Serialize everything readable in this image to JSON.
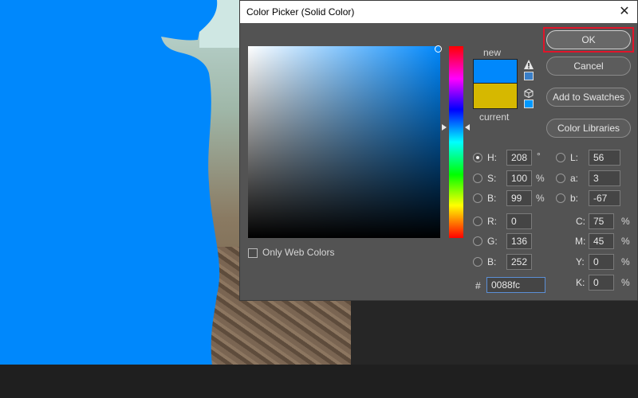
{
  "dialog": {
    "title": "Color Picker (Solid Color)",
    "close_glyph": "✕",
    "buttons": {
      "ok": "OK",
      "cancel": "Cancel",
      "add_to_swatches": "Add to Swatches",
      "color_libraries": "Color Libraries"
    },
    "swatch": {
      "new_label": "new",
      "current_label": "current",
      "new_color": "#0088fc",
      "current_color": "#d6b800"
    },
    "only_web_colors": "Only Web Colors",
    "hsb": {
      "h_label": "H:",
      "h_value": "208",
      "h_unit": "°",
      "s_label": "S:",
      "s_value": "100",
      "s_unit": "%",
      "b_label": "B:",
      "b_value": "99",
      "b_unit": "%"
    },
    "rgb": {
      "r_label": "R:",
      "r_value": "0",
      "g_label": "G:",
      "g_value": "136",
      "b_label": "B:",
      "b_value": "252"
    },
    "lab": {
      "l_label": "L:",
      "l_value": "56",
      "a_label": "a:",
      "a_value": "3",
      "b_label": "b:",
      "b_value": "-67"
    },
    "cmyk": {
      "c_label": "C:",
      "c_value": "75",
      "m_label": "M:",
      "m_value": "45",
      "y_label": "Y:",
      "y_value": "0",
      "k_label": "K:",
      "k_value": "0",
      "unit": "%"
    },
    "hex": {
      "label": "#",
      "value": "0088fc"
    },
    "selected_mode": "H"
  },
  "colors": {
    "mask_blue": "#0088fc",
    "highlight_red": "#e0152a"
  }
}
